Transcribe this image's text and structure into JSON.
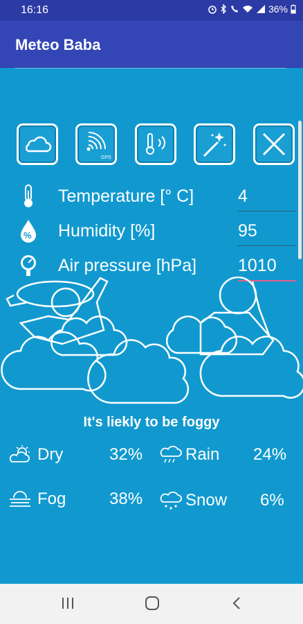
{
  "status": {
    "time": "16:16",
    "battery": "36%"
  },
  "app": {
    "title": "Meteo Baba"
  },
  "toolbar": {
    "buttons": [
      {
        "name": "weather",
        "icon": "cloud-icon"
      },
      {
        "name": "gps",
        "icon": "gps-signal-icon",
        "label": "GPS"
      },
      {
        "name": "sensor",
        "icon": "thermometer-sensor-icon"
      },
      {
        "name": "magic",
        "icon": "magic-wand-icon"
      },
      {
        "name": "close",
        "icon": "close-icon"
      }
    ]
  },
  "readings": [
    {
      "icon": "thermometer-icon",
      "label": "Temperature [° C]",
      "value": "4"
    },
    {
      "icon": "humidity-drop-icon",
      "label": "Humidity [%]",
      "value": "95"
    },
    {
      "icon": "barometer-icon",
      "label": "Air pressure [hPa]",
      "value": "1010"
    }
  ],
  "forecast": {
    "headline": "It's liekly to be foggy",
    "items": [
      {
        "icon": "sun-cloud-icon",
        "label": "Dry",
        "value": "32%"
      },
      {
        "icon": "rain-cloud-icon",
        "label": "Rain",
        "value": "24%"
      },
      {
        "icon": "fog-icon",
        "label": "Fog",
        "value": "38%"
      },
      {
        "icon": "snow-cloud-icon",
        "label": "Snow",
        "value": "6%"
      }
    ]
  },
  "colors": {
    "background": "#1199CF",
    "appbar": "#3446b5",
    "statusbar": "#2b3aa4",
    "focus_underline": "#e0608a"
  }
}
